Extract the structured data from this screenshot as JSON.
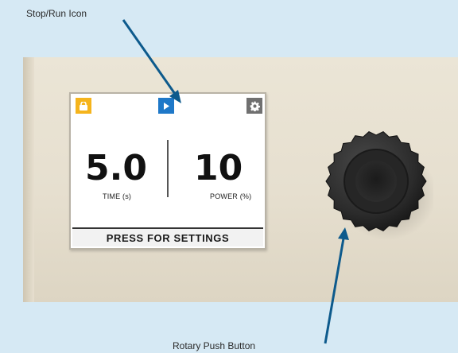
{
  "annotations": {
    "stop_run": "Stop/Run Icon",
    "rotary": "Rotary Push Button"
  },
  "display": {
    "time": {
      "value": "5.0",
      "label": "TIME (s)"
    },
    "power": {
      "value": "10",
      "label": "POWER (%)"
    },
    "footer": "PRESS FOR SETTINGS",
    "icons": {
      "left": "lock-icon",
      "center": "play-icon",
      "right": "gear-icon"
    }
  },
  "colors": {
    "background": "#d6e9f4",
    "lock": "#f5b41c",
    "run": "#1e78c8",
    "settings": "#707070",
    "arrow": "#0d5a8c",
    "knob": "#2b2b2b"
  }
}
